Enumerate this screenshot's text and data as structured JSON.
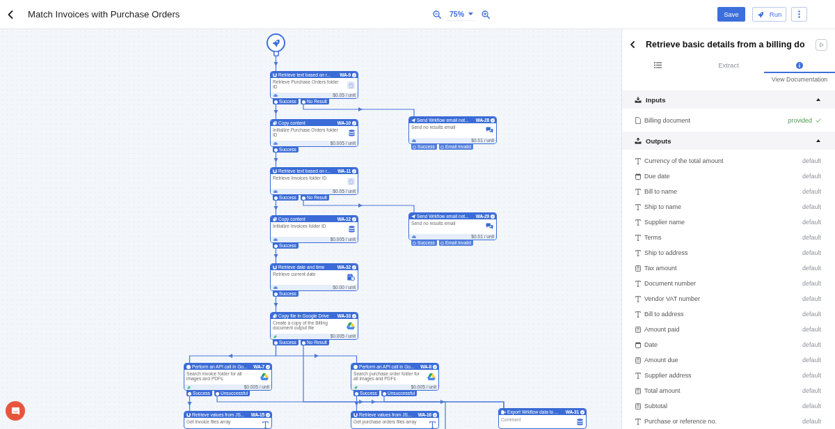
{
  "header": {
    "title": "Match Invoices with Purchase Orders",
    "zoom": "75%",
    "actions": [
      {
        "kind": "save",
        "label": "Save"
      },
      {
        "kind": "run",
        "label": "Run"
      },
      {
        "kind": "more"
      }
    ]
  },
  "canvas": {
    "nodes": [
      {
        "kind": "ocr",
        "title": "Retrieve text based on r...",
        "ref": "WA-9",
        "description": "Retrieve Purchase Orders folder ID",
        "price": "$0.05 / unit",
        "outputs": [
          {
            "label": "Success",
            "connected": true
          },
          {
            "label": "No Result",
            "connected": true
          }
        ]
      },
      {
        "kind": "copy",
        "title": "Copy content",
        "ref": "WA-10",
        "description": "Initialize Purchase Orders folder ID",
        "price": "$0.005 / unit",
        "outputs": [
          {
            "label": "Success",
            "connected": true
          }
        ]
      },
      {
        "kind": "email",
        "title": "Send Wrkflow email not...",
        "ref": "WA-28",
        "description": "Send no results email",
        "price": "$0.01 / unit",
        "outputs": [
          {
            "label": "Success",
            "connected": false
          },
          {
            "label": "Email invalid",
            "connected": false
          }
        ]
      },
      {
        "kind": "ocr",
        "title": "Retrieve text based on r...",
        "ref": "WA-11",
        "description": "Retrieve Invoices folder ID",
        "price": "$0.05 / unit",
        "outputs": [
          {
            "label": "Success",
            "connected": true
          },
          {
            "label": "No Result",
            "connected": true
          }
        ]
      },
      {
        "kind": "copy",
        "title": "Copy content",
        "ref": "WA-12",
        "description": "Initialize Invoices folder ID",
        "price": "$0.005 / unit",
        "outputs": [
          {
            "label": "Success",
            "connected": true
          }
        ]
      },
      {
        "kind": "email",
        "title": "Send Wrkflow email not...",
        "ref": "WA-29",
        "description": "Send no results email",
        "price": "$0.01 / unit",
        "outputs": [
          {
            "label": "Success",
            "connected": false
          },
          {
            "label": "Email invalid",
            "connected": false
          }
        ]
      },
      {
        "kind": "date",
        "title": "Retrieve date and time",
        "ref": "WA-32",
        "description": "Retrieve current date",
        "price": "$0.00 / unit",
        "outputs": [
          {
            "label": "Success",
            "connected": true
          }
        ]
      },
      {
        "kind": "drivecopy",
        "title": "Copy file in Google Drive",
        "ref": "WA-33",
        "description": "Create a copy of the Billing document output file",
        "price": "$0.005 / unit",
        "outputs": [
          {
            "label": "Success",
            "connected": true
          },
          {
            "label": "No Result",
            "connected": true
          }
        ]
      },
      {
        "kind": "driveapi",
        "title": "Perform an API call in Go...",
        "ref": "WA-7",
        "description": "Search invoice folder for all images and PDFs",
        "price": "$0.005 / unit",
        "outputs": [
          {
            "label": "Success",
            "connected": true
          },
          {
            "label": "Unsuccessful",
            "connected": true
          }
        ]
      },
      {
        "kind": "driveapi",
        "title": "Perform an API call in Go...",
        "ref": "WA-8",
        "description": "Search purchase order folder for all images and PDFs",
        "price": "$0.005 / unit",
        "outputs": [
          {
            "label": "Success",
            "connected": true
          },
          {
            "label": "Unsuccessful",
            "connected": true
          }
        ]
      },
      {
        "kind": "json",
        "title": "Retrieve values from JS...",
        "ref": "WA-15",
        "description": "Get invoice files array"
      },
      {
        "kind": "json",
        "title": "Retrieve values from JS...",
        "ref": "WA-16",
        "description": "Get purchase orders files array"
      },
      {
        "kind": "export",
        "title": "Export Wrkflow data to ...",
        "ref": "WA-31",
        "placeholder": "Comment"
      }
    ]
  },
  "panel": {
    "title": "Retrieve basic details from a billing do",
    "tabs": [
      {
        "kind": "list",
        "selected": false
      },
      {
        "kind": "text",
        "label": "Extract",
        "selected": false
      },
      {
        "kind": "info",
        "selected": true,
        "caption": "View Documentation"
      }
    ],
    "sections": [
      {
        "kind": "inputs",
        "title": "Inputs",
        "expanded": true,
        "items": [
          {
            "kind": "file",
            "label": "Billing document",
            "value": "provided",
            "provided": true
          }
        ]
      },
      {
        "kind": "outputs",
        "title": "Outputs",
        "expanded": true,
        "items": [
          {
            "kind": "text",
            "label": "Currency of the total amount",
            "value": "default",
            "provided": false
          },
          {
            "kind": "date",
            "label": "Due date",
            "value": "default",
            "provided": false
          },
          {
            "kind": "text",
            "label": "Bill to name",
            "value": "default",
            "provided": false
          },
          {
            "kind": "text",
            "label": "Ship to name",
            "value": "default",
            "provided": false
          },
          {
            "kind": "text",
            "label": "Supplier name",
            "value": "default",
            "provided": false
          },
          {
            "kind": "text",
            "label": "Terms",
            "value": "default",
            "provided": false
          },
          {
            "kind": "text",
            "label": "Ship to address",
            "value": "default",
            "provided": false
          },
          {
            "kind": "number",
            "label": "Tax amount",
            "value": "default",
            "provided": false
          },
          {
            "kind": "text",
            "label": "Document number",
            "value": "default",
            "provided": false
          },
          {
            "kind": "text",
            "label": "Vendor VAT number",
            "value": "default",
            "provided": false
          },
          {
            "kind": "text",
            "label": "Bill to address",
            "value": "default",
            "provided": false
          },
          {
            "kind": "number",
            "label": "Amount paid",
            "value": "default",
            "provided": false
          },
          {
            "kind": "date",
            "label": "Date",
            "value": "default",
            "provided": false
          },
          {
            "kind": "number",
            "label": "Amount due",
            "value": "default",
            "provided": false
          },
          {
            "kind": "text",
            "label": "Supplier address",
            "value": "default",
            "provided": false
          },
          {
            "kind": "number",
            "label": "Total amount",
            "value": "default",
            "provided": false
          },
          {
            "kind": "number",
            "label": "Subtotal",
            "value": "default",
            "provided": false
          },
          {
            "kind": "text",
            "label": "Purchase or reference no.",
            "value": "default",
            "provided": false
          }
        ]
      }
    ]
  }
}
